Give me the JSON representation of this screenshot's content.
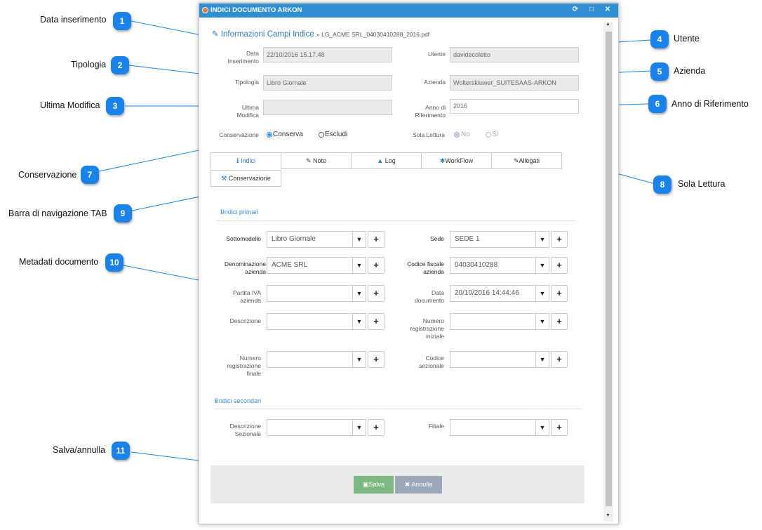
{
  "window": {
    "title": "INDICI DOCUMENTO ARKON",
    "controls": [
      "refresh-icon",
      "maximize-icon",
      "close-icon"
    ]
  },
  "breadcrumb": {
    "icon": "edit-icon",
    "title": "Informazioni Campi Indice",
    "sub": "» LG_ACME SRL_04030410288_2016.pdf"
  },
  "fields": {
    "data_inserimento": {
      "label": "Data\nInserimento",
      "value": "22/10/2016 15.17.48"
    },
    "tipologia": {
      "label": "Tipologia",
      "value": "Libro Giornale"
    },
    "ultima_modifica": {
      "label": "Ultima\nModifica",
      "value": ""
    },
    "utente": {
      "label": "Utente",
      "value": "davidecoletto"
    },
    "azienda": {
      "label": "Azienda",
      "value": "Wolterskluwer_SUITESAAS-ARKON"
    },
    "anno_riferimento": {
      "label": "Anno di\nRiferimento",
      "value": "2016"
    }
  },
  "conservazione": {
    "label": "Conservazione",
    "options": [
      "Conserva",
      "Escludi"
    ],
    "selected": "Conserva"
  },
  "sola_lettura": {
    "label": "Sola Lettura",
    "options": [
      "No",
      "Sì"
    ],
    "selected": "No"
  },
  "tabs": [
    {
      "label": "Indici",
      "icon": "info-icon",
      "active": true
    },
    {
      "label": "Note",
      "icon": "edit-icon"
    },
    {
      "label": "Log",
      "icon": "warning-icon"
    },
    {
      "label": "WorkFlow",
      "icon": "gear-icon"
    },
    {
      "label": "Allegati",
      "icon": "paperclip-icon"
    },
    {
      "label": "Conservazione",
      "icon": "gavel-icon"
    }
  ],
  "sections": {
    "primari": "Indici primari",
    "secondari": "Indici secondari"
  },
  "indici_primari": {
    "sottomodello": {
      "label": "Sottomodello",
      "value": "Libro Giornale"
    },
    "sede": {
      "label": "Sede",
      "value": "SEDE 1"
    },
    "denominazione": {
      "label": "Denominazione\nazienda",
      "value": "ACME SRL"
    },
    "codice_fiscale": {
      "label": "Codice fiscale\nazienda",
      "value": "04030410288"
    },
    "partita_iva": {
      "label": "Partita IVA\nazienda",
      "value": ""
    },
    "data_documento": {
      "label": "Data\ndocumento",
      "value": "20/10/2016 14:44:46"
    },
    "descrizione": {
      "label": "Descrizione",
      "value": ""
    },
    "num_reg_iniziale": {
      "label": "Numero\nregistrazione\niniziale",
      "value": ""
    },
    "num_reg_finale": {
      "label": "Numero\nregistrazione\nfinale",
      "value": ""
    },
    "codice_sezionale": {
      "label": "Codice\nsezionale",
      "value": ""
    }
  },
  "indici_secondari": {
    "descrizione_sezionale": {
      "label": "Descrizione\nSezionale",
      "value": ""
    },
    "filiale": {
      "label": "Filiale",
      "value": ""
    }
  },
  "buttons": {
    "save": "Salva",
    "cancel": "Annulla"
  },
  "plus_symbol": "+",
  "caret_symbol": "▼",
  "callouts": [
    {
      "n": "1",
      "label": "Data inserimento"
    },
    {
      "n": "2",
      "label": "Tipologia"
    },
    {
      "n": "3",
      "label": "Ultima Modifica"
    },
    {
      "n": "4",
      "label": "Utente"
    },
    {
      "n": "5",
      "label": "Azienda"
    },
    {
      "n": "6",
      "label": "Anno di Riferimento"
    },
    {
      "n": "7",
      "label": "Conservazione"
    },
    {
      "n": "8",
      "label": "Sola Lettura"
    },
    {
      "n": "9",
      "label": "Barra di navigazione TAB"
    },
    {
      "n": "10",
      "label": "Metadati documento"
    },
    {
      "n": "11",
      "label": "Salva/annulla"
    }
  ],
  "colors": {
    "titlebar": "#2f8fd0",
    "callout": "#1a82e8",
    "save": "#7cb87f",
    "cancel": "#9aa8b8",
    "accent": "#3478b7"
  }
}
